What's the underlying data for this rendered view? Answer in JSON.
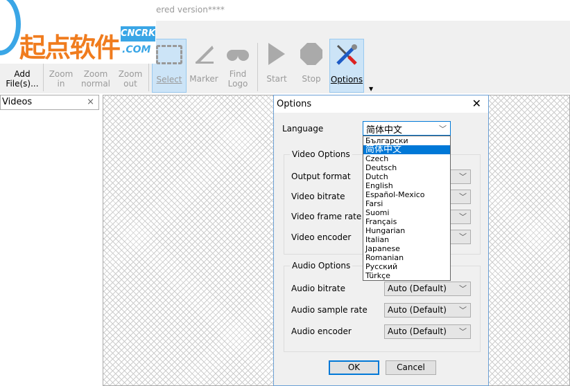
{
  "window": {
    "title": "ered version****"
  },
  "logo": {
    "text": "起点软件",
    "badge": "CNCRK .COM"
  },
  "toolbar": {
    "add": "Add File(s)...",
    "zoom_in": "Zoom in",
    "zoom_normal": "Zoom normal",
    "zoom_out": "Zoom out",
    "select": "Select",
    "marker": "Marker",
    "find_logo": "Find Logo",
    "start": "Start",
    "stop": "Stop",
    "options": "Options"
  },
  "panel": {
    "tab": "Videos",
    "close": "×"
  },
  "dialog": {
    "title": "Options",
    "close": "✕",
    "language_label": "Language",
    "language_value": "简体中文",
    "languages": [
      "Български",
      "简体中文",
      "Czech",
      "Deutsch",
      "Dutch",
      "English",
      "Español-Mexico",
      "Farsi",
      "Suomi",
      "Français",
      "Hungarian",
      "Italian",
      "Japanese",
      "Romanian",
      "Русский",
      "Türkçe"
    ],
    "video_group": "Video Options",
    "video_rows": [
      "Output format",
      "Video bitrate",
      "Video frame rate",
      "Video encoder"
    ],
    "audio_group": "Audio Options",
    "audio_rows": [
      {
        "label": "Audio bitrate",
        "value": "Auto (Default)"
      },
      {
        "label": "Audio sample rate",
        "value": "Auto (Default)"
      },
      {
        "label": "Audio encoder",
        "value": "Auto (Default)"
      }
    ],
    "ok": "OK",
    "cancel": "Cancel"
  }
}
